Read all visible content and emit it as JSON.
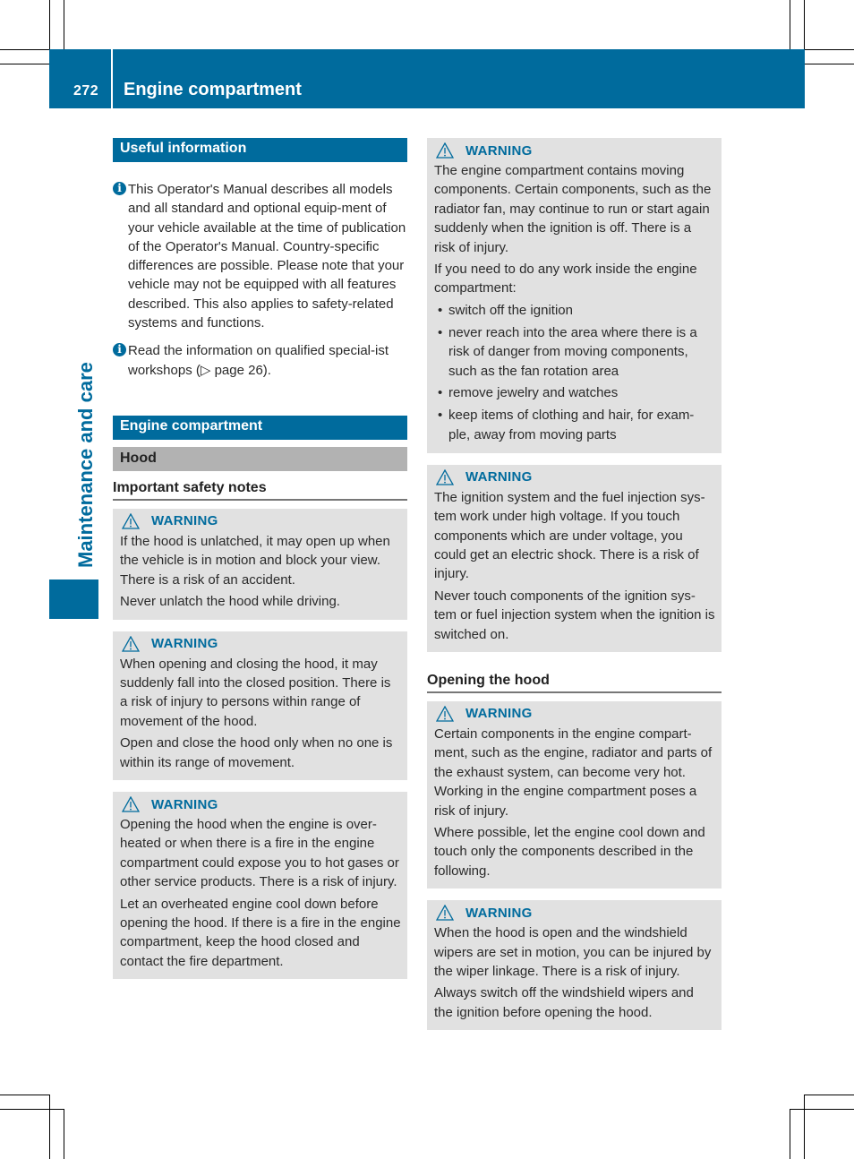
{
  "header": {
    "page_number": "272",
    "title": "Engine compartment"
  },
  "side_tab": {
    "label": "Maintenance and care"
  },
  "colors": {
    "accent": "#006b9d",
    "warning_bg": "#e1e1e1",
    "subsection_bg": "#b2b2b2"
  },
  "left_column": {
    "useful_info": {
      "heading": "Useful information",
      "notes": [
        "This Operator's Manual describes all models and all standard and optional equip-ment of your vehicle available at the time of publication of the Operator's Manual. Country-specific differences are possible. Please note that your vehicle may not be equipped with all features described. This also applies to safety-related systems and functions.",
        "Read the information on qualified special-ist workshops (▷ page 26)."
      ]
    },
    "section_heading": "Engine compartment",
    "subsection_heading": "Hood",
    "safety_heading": "Important safety notes",
    "warnings": [
      {
        "title": "WARNING",
        "paragraphs": [
          "If the hood is unlatched, it may open up when the vehicle is in motion and block your view. There is a risk of an accident.",
          "Never unlatch the hood while driving."
        ]
      },
      {
        "title": "WARNING",
        "paragraphs": [
          "When opening and closing the hood, it may suddenly fall into the closed position. There is a risk of injury to persons within range of movement of the hood.",
          "Open and close the hood only when no one is within its range of movement."
        ]
      },
      {
        "title": "WARNING",
        "paragraphs": [
          "Opening the hood when the engine is over-heated or when there is a fire in the engine compartment could expose you to hot gases or other service products. There is a risk of injury.",
          "Let an overheated engine cool down before opening the hood. If there is a fire in the engine compartment, keep the hood closed and contact the fire department."
        ]
      }
    ]
  },
  "right_column": {
    "warnings_top": [
      {
        "title": "WARNING",
        "paragraphs": [
          "The engine compartment contains moving components. Certain components, such as the radiator fan, may continue to run or start again suddenly when the ignition is off. There is a risk of injury.",
          "If you need to do any work inside the engine compartment:"
        ],
        "bullets": [
          "switch off the ignition",
          "never reach into the area where there is a risk of danger from moving components, such as the fan rotation area",
          "remove jewelry and watches",
          "keep items of clothing and hair, for exam-ple, away from moving parts"
        ]
      },
      {
        "title": "WARNING",
        "paragraphs": [
          "The ignition system and the fuel injection sys-tem work under high voltage. If you touch components which are under voltage, you could get an electric shock. There is a risk of injury.",
          "Never touch components of the ignition sys-tem or fuel injection system when the ignition is switched on."
        ]
      }
    ],
    "opening_heading": "Opening the hood",
    "warnings_bottom": [
      {
        "title": "WARNING",
        "paragraphs": [
          "Certain components in the engine compart-ment, such as the engine, radiator and parts of the exhaust system, can become very hot. Working in the engine compartment poses a risk of injury.",
          "Where possible, let the engine cool down and touch only the components described in the following."
        ]
      },
      {
        "title": "WARNING",
        "paragraphs": [
          "When the hood is open and the windshield wipers are set in motion, you can be injured by the wiper linkage. There is a risk of injury.",
          "Always switch off the windshield wipers and the ignition before opening the hood."
        ]
      }
    ]
  }
}
